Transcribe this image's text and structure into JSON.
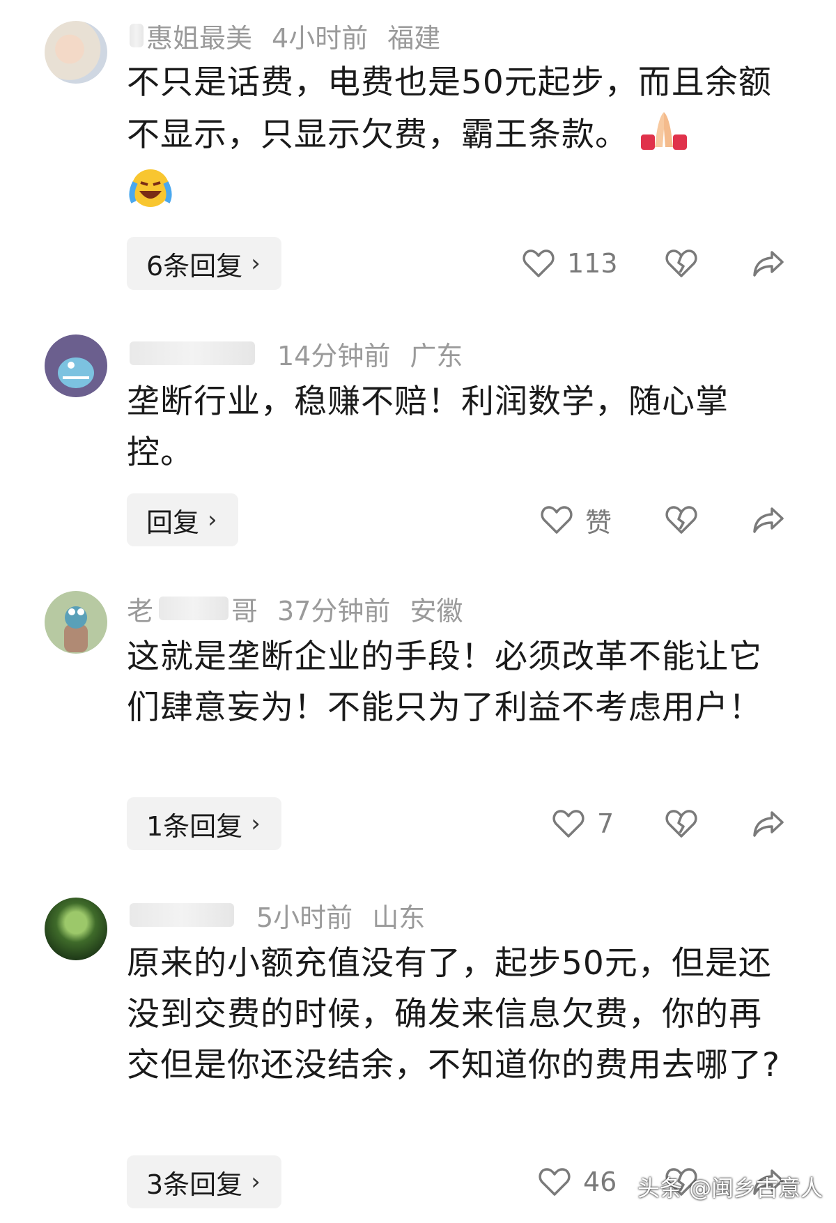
{
  "comments": [
    {
      "user": "惠姐最美",
      "time": "4小时前",
      "region": "福建",
      "text": "不只是话费，电费也是50元起步，而且余额不显示，只显示欠费，霸王条款。",
      "emojis": [
        "folded-hands",
        "laughing-crying"
      ],
      "reply_label": "6条回复",
      "likes": "113"
    },
    {
      "user": "",
      "time": "14分钟前",
      "region": "广东",
      "text": "垄断行业，稳赚不赔！利润数学，随心掌控。",
      "reply_label": "回复",
      "likes": "赞"
    },
    {
      "user": "老",
      "user_suffix": "哥",
      "time": "37分钟前",
      "region": "安徽",
      "text": "这就是垄断企业的手段！必须改革不能让它们肆意妄为！不能只为了利益不考虑用户！",
      "reply_label": "1条回复",
      "likes": "7"
    },
    {
      "user": "",
      "time": "5小时前",
      "region": "山东",
      "text": "原来的小额充值没有了，起步50元，但是还没到交费的时候，确发来信息欠费，你的再交但是你还没结余，不知道你的费用去哪了?",
      "reply_label": "3条回复",
      "likes": "46"
    }
  ],
  "watermark": "头条 @闽乡古意人",
  "icons": {
    "like": "heart-outline-icon",
    "dislike": "broken-heart-icon",
    "share": "share-arrow-icon",
    "chevron": "chevron-right-icon"
  },
  "colors": {
    "text": "#1a1a1a",
    "meta": "#9a9a9a",
    "reply_bg": "#f2f2f2",
    "icon": "#7a7a7a"
  }
}
